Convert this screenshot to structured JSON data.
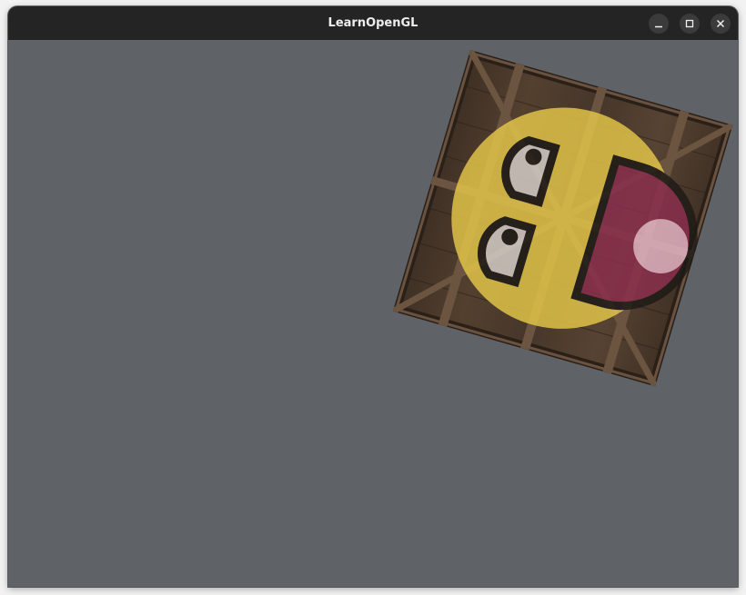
{
  "window": {
    "title": "LearnOpenGL",
    "buttons": {
      "minimize": "minimize-icon",
      "maximize": "maximize-icon",
      "close": "close-icon"
    }
  },
  "colors": {
    "titlebar": "#242424",
    "clear_color": "#5f6368",
    "crate_wood": "#4b3a2c",
    "smiley_yellow": "#e6c84a",
    "smiley_outline": "#1e1a16",
    "smiley_mouth": "#8b2e4e",
    "smiley_highlight": "#e8b8c8",
    "smiley_eyes": "#d8d2cc"
  }
}
